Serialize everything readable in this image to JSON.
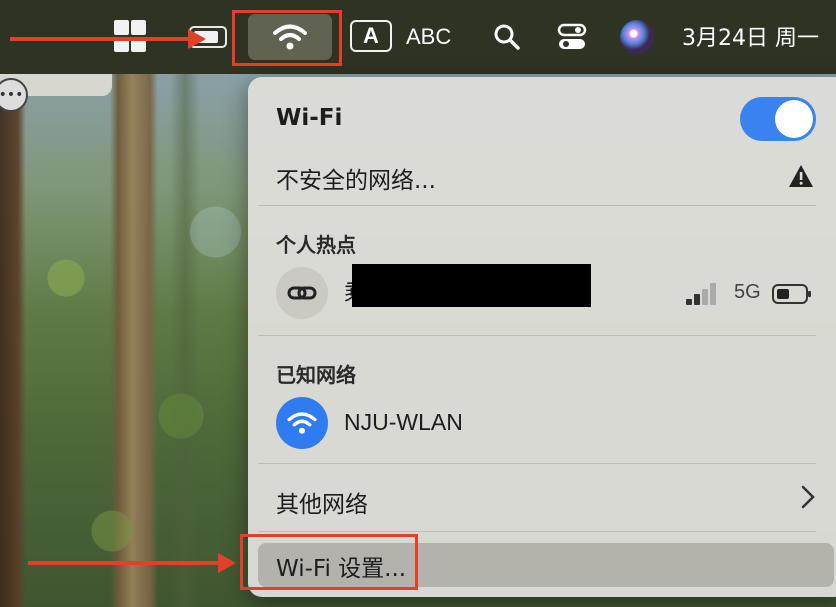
{
  "menubar": {
    "input_method_label": "A",
    "input_source_label": "ABC",
    "datetime": "3月24日 周一",
    "icons": [
      "window-grid-icon",
      "battery-icon",
      "wifi-icon",
      "search-icon",
      "control-center-icon",
      "siri-icon"
    ]
  },
  "wifi_menu": {
    "title": "Wi-Fi",
    "toggle_on": true,
    "insecure_network_label": "不安全的网络...",
    "hotspot_section": "个人热点",
    "hotspot": {
      "name_visible": "乘",
      "band": "5G"
    },
    "known_section": "已知网络",
    "known_networks": [
      {
        "name": "NJU-WLAN"
      }
    ],
    "other_networks_label": "其他网络",
    "settings_label": "Wi-Fi 设置..."
  },
  "colors": {
    "accent": "#3a82f0",
    "annotation": "#e2402a",
    "menubar": "#2e3324"
  }
}
